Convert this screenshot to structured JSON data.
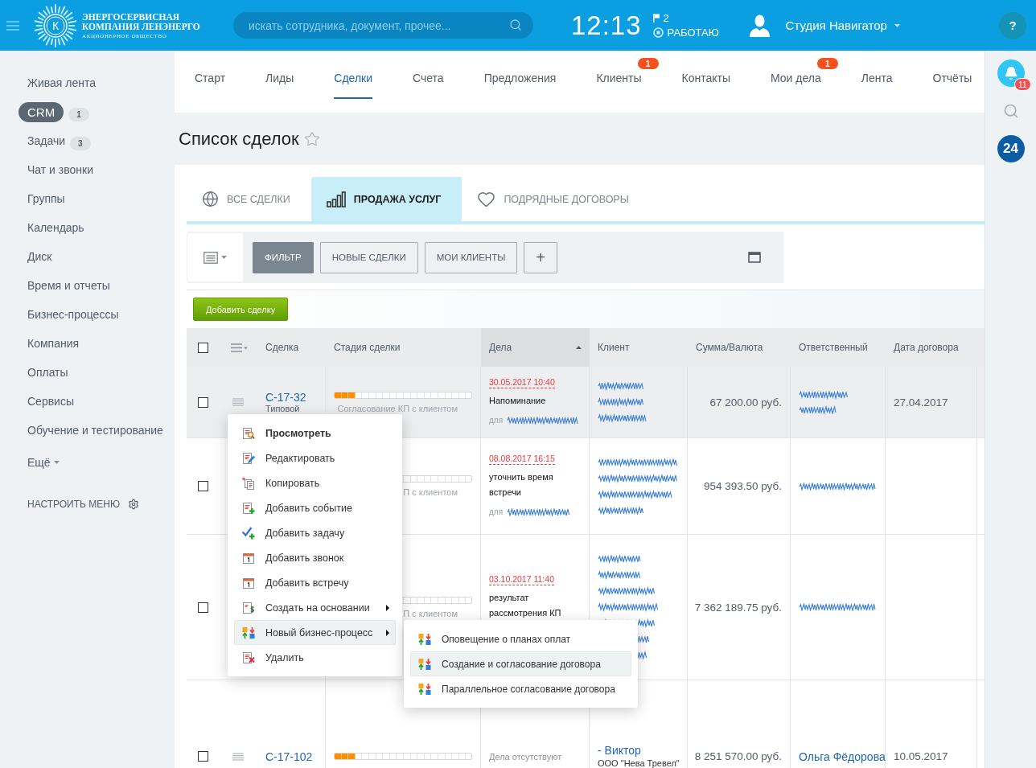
{
  "header": {
    "logo": {
      "mark": "К",
      "line_1": "ЭНЕРГОСЕРВИСНАЯ",
      "line_2": "КОМПАНИЯ ЛЕНЭНЕРГО",
      "line_3": "АКЦИОНЕРНОЕ ОБЩЕСТВО"
    },
    "search": {
      "placeholder": "искать сотрудника, документ, прочее..."
    },
    "clock": "12:13",
    "flag_count": "2",
    "status": "РАБОТАЮ",
    "user": "Студия Навигатор",
    "help": "?"
  },
  "sidebar": {
    "items": [
      {
        "label": "Живая лента",
        "kind": "link",
        "selected": false
      },
      {
        "label": "CRM",
        "kind": "link",
        "selected": true,
        "counter": "1"
      },
      {
        "label": "Задачи",
        "kind": "link",
        "selected": false,
        "counter": "3"
      },
      {
        "label": "Чат и звонки",
        "kind": "link",
        "selected": false
      },
      {
        "label": "Группы",
        "kind": "link",
        "selected": false
      },
      {
        "label": "Календарь",
        "kind": "link",
        "selected": false
      },
      {
        "label": "Диск",
        "kind": "link",
        "selected": false
      },
      {
        "label": "Время и отчеты",
        "kind": "link",
        "selected": false
      },
      {
        "label": "Бизнес-процессы",
        "kind": "link",
        "selected": false
      },
      {
        "label": "Компания",
        "kind": "link",
        "selected": false
      },
      {
        "label": "Оплаты",
        "kind": "link",
        "selected": false
      },
      {
        "label": "Сервисы",
        "kind": "link",
        "selected": false
      },
      {
        "label": "Обучение и тестирование",
        "kind": "link",
        "selected": false
      },
      {
        "label": "Ещё",
        "kind": "more",
        "selected": false
      }
    ],
    "configure": "НАСТРОИТЬ МЕНЮ"
  },
  "top_nav": [
    {
      "label": "Старт",
      "selected": false
    },
    {
      "label": "Лиды",
      "selected": false
    },
    {
      "label": "Сделки",
      "selected": true
    },
    {
      "label": "Счета",
      "selected": false
    },
    {
      "label": "Предложения",
      "selected": false
    },
    {
      "label": "Клиенты",
      "selected": false,
      "badge": "1"
    },
    {
      "label": "Контакты",
      "selected": false
    },
    {
      "label": "Мои дела",
      "selected": false,
      "badge": "1"
    },
    {
      "label": "Лента",
      "selected": false
    },
    {
      "label": "Отчёты",
      "selected": false
    }
  ],
  "page_title": "Список сделок",
  "categories": [
    {
      "label": "ВСЕ СДЕЛКИ",
      "selected": false
    },
    {
      "label": "ПРОДАЖА УСЛУГ",
      "selected": true
    },
    {
      "label": "ПОДРЯДНЫЕ ДОГОВОРЫ",
      "selected": false
    }
  ],
  "filter_buttons": [
    {
      "label": "ФИЛЬТР",
      "selected": true
    },
    {
      "label": "НОВЫЕ СДЕЛКИ",
      "selected": false
    },
    {
      "label": "МОИ КЛИЕНТЫ",
      "selected": false
    },
    {
      "label": "+",
      "selected": false
    }
  ],
  "add_button": "Добавить сделку",
  "table": {
    "select_all": {
      "checked": false
    },
    "columns": [
      {
        "label": "Сделка",
        "sorted": false
      },
      {
        "label": "Стадия сделки",
        "sorted": false
      },
      {
        "label": "Дела",
        "sorted": true
      },
      {
        "label": "Клиент",
        "sorted": false
      },
      {
        "label": "Сумма/Валюта",
        "sorted": false
      },
      {
        "label": "Ответственный",
        "sorted": false
      },
      {
        "label": "Дата договора",
        "sorted": false
      }
    ],
    "rows": [
      {
        "highlighted": true,
        "checked": false,
        "deal_id": "С-17-32",
        "deal_type": "Типовой",
        "stage": {
          "level": 0.15,
          "label": "Согласование КП с клиентом"
        },
        "activity": {
          "kind": "task",
          "date": "30.05.2017 10:40",
          "text": "Напоминание",
          "assignee": {
            "prefix": "для",
            "kind": "scribbled"
          }
        },
        "client": {
          "kind": "scribbled"
        },
        "amount": "67 200.00 руб.",
        "responsible": {
          "kind": "scribbled"
        },
        "contract_date": "27.04.2017"
      },
      {
        "highlighted": false,
        "checked": false,
        "stage": {
          "label": "П с клиентом"
        },
        "activity": {
          "kind": "task",
          "date": "08.08.2017 16:15",
          "text": "уточнить время встречи",
          "assignee": {
            "prefix": "для",
            "kind": "scribbled"
          }
        },
        "client": {
          "kind": "scribbled"
        },
        "amount": "954 393.50 руб.",
        "responsible": {
          "kind": "scribbled"
        }
      },
      {
        "highlighted": false,
        "checked": false,
        "stage": {
          "label": "П с клиентом"
        },
        "activity": {
          "kind": "task",
          "date": "03.10.2017 11:40",
          "text": "результат рассмотрения КП"
        },
        "client": {
          "kind": "scribbled"
        },
        "amount": "7 362 189.75 руб.",
        "responsible": {
          "kind": "scribbled"
        }
      },
      {
        "highlighted": false,
        "checked": false,
        "deal_id": "С-17-102",
        "stage": {
          "level": 0.15
        },
        "activity": {
          "kind": "none",
          "text": "Дела отсутствуют"
        },
        "client": {
          "kind": "named",
          "name": "- Виктор",
          "company": "ООО \"Нева Тревел\""
        },
        "amount": "8 251 570.00 руб.",
        "responsible": {
          "kind": "named",
          "name": "Ольга Фёдорова"
        },
        "contract_date": "10.05.2017"
      }
    ]
  },
  "context_menu": {
    "items": [
      {
        "label": "Просмотреть",
        "kind": "default",
        "selected": false
      },
      {
        "label": "Редактировать",
        "kind": "action",
        "selected": false
      },
      {
        "label": "Копировать",
        "kind": "action",
        "selected": false
      },
      {
        "label": "Добавить событие",
        "kind": "action",
        "selected": false
      },
      {
        "label": "Добавить задачу",
        "kind": "action",
        "selected": false
      },
      {
        "label": "Добавить звонок",
        "kind": "action",
        "selected": false
      },
      {
        "label": "Добавить встречу",
        "kind": "action",
        "selected": false
      },
      {
        "label": "Создать на основании",
        "kind": "submenu",
        "selected": false
      },
      {
        "label": "Новый бизнес-процесс",
        "kind": "submenu",
        "selected": true,
        "children": [
          {
            "label": "Оповещение о планах оплат",
            "selected": false
          },
          {
            "label": "Создание и согласование договора",
            "selected": true
          },
          {
            "label": "Параллельное согласование договора",
            "selected": false
          }
        ]
      },
      {
        "label": "Удалить",
        "kind": "action",
        "selected": false
      }
    ]
  },
  "right_bar": {
    "notifications": "11",
    "counter": "24"
  }
}
